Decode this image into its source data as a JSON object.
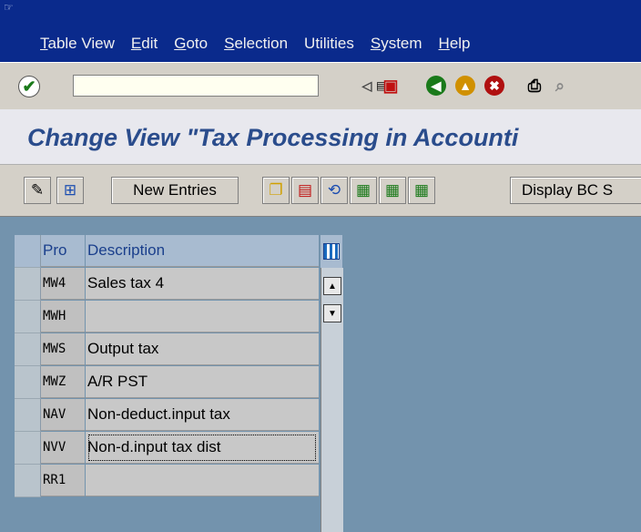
{
  "menu": {
    "items": [
      "Table View",
      "Edit",
      "Goto",
      "Selection",
      "Utilities",
      "System",
      "Help"
    ]
  },
  "toolbar": {
    "icons": [
      "enter-icon",
      "back-icon",
      "save-icon",
      "back-arrow-icon",
      "exit-icon",
      "cancel-icon",
      "print-icon",
      "find-icon"
    ]
  },
  "title": "Change View \"Tax Processing in Accounti",
  "app_toolbar": {
    "new_entries_label": "New Entries",
    "display_bc_label": "Display BC S"
  },
  "table": {
    "headers": {
      "code": "Pro",
      "description": "Description"
    },
    "rows": [
      {
        "code": "MW4",
        "description": "Sales tax 4"
      },
      {
        "code": "MWH",
        "description": ""
      },
      {
        "code": "MWS",
        "description": "Output tax"
      },
      {
        "code": "MWZ",
        "description": "A/R PST"
      },
      {
        "code": "NAV",
        "description": "Non-deduct.input tax"
      },
      {
        "code": "NVV",
        "description": "Non-d.input tax dist"
      },
      {
        "code": "RR1",
        "description": ""
      }
    ]
  }
}
